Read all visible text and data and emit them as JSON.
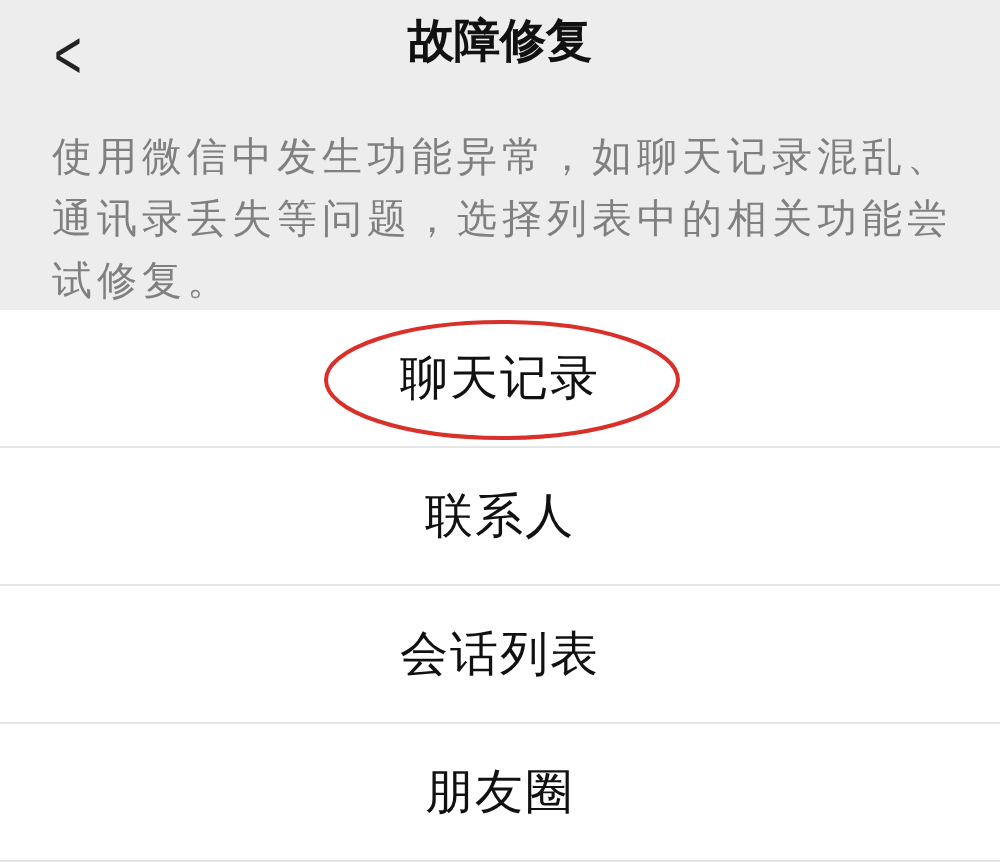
{
  "header": {
    "back": "<",
    "title": "故障修复"
  },
  "description": "使用微信中发生功能异常，如聊天记录混乱、通讯录丢失等问题，选择列表中的相关功能尝试修复。",
  "items": [
    {
      "label": "聊天记录",
      "circled": true
    },
    {
      "label": "联系人",
      "circled": false
    },
    {
      "label": "会话列表",
      "circled": false
    },
    {
      "label": "朋友圈",
      "circled": false
    }
  ]
}
